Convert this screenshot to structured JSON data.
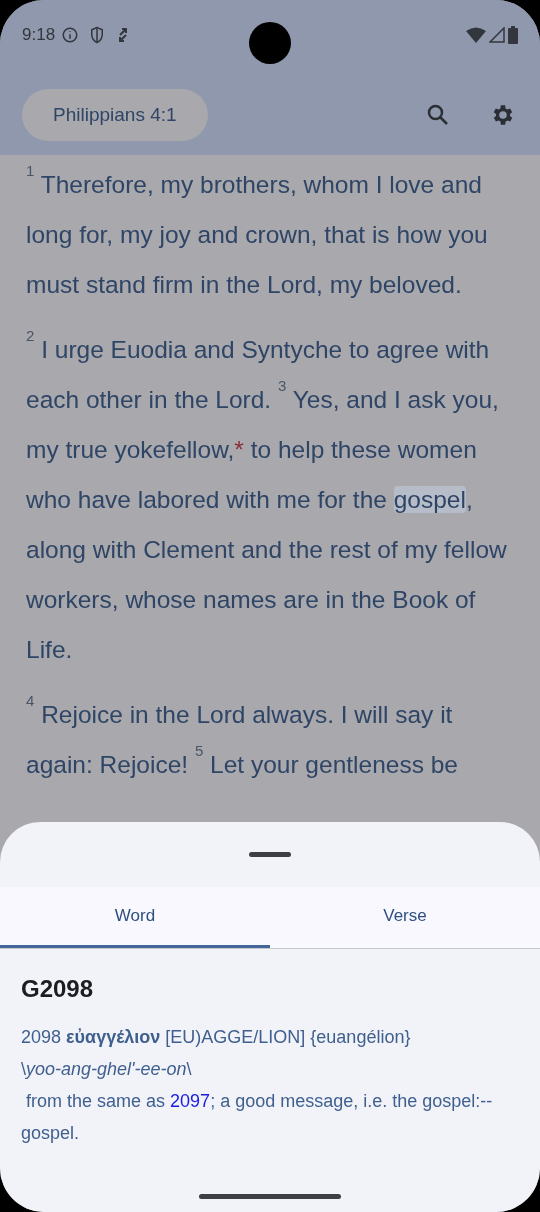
{
  "status_bar": {
    "time": "9:18"
  },
  "app_bar": {
    "reference": "Philippians 4:1"
  },
  "passage": [
    {
      "segments": [
        {
          "kind": "verse_number",
          "text": "1"
        },
        {
          "kind": "text",
          "text": " Therefore, my brothers, whom I love and long for, my joy and crown, that is how you must stand firm in the Lord, my beloved."
        }
      ]
    },
    {
      "segments": [
        {
          "kind": "verse_number",
          "text": "2"
        },
        {
          "kind": "text",
          "text": " I urge Euodia and Syntyche to agree with each other in the Lord. "
        },
        {
          "kind": "verse_number",
          "text": "3"
        },
        {
          "kind": "text",
          "text": " Yes, and I ask you, my true yokefellow,"
        },
        {
          "kind": "footnote_mark",
          "text": "*"
        },
        {
          "kind": "text",
          "text": " to help these women who have labored with me for the "
        },
        {
          "kind": "highlight",
          "text": "gospel"
        },
        {
          "kind": "text",
          "text": ", along with Clement and the rest of my fellow workers, whose names are in the Book of Life."
        }
      ]
    },
    {
      "segments": [
        {
          "kind": "verse_number",
          "text": "4"
        },
        {
          "kind": "text",
          "text": " Rejoice in the Lord always. I will say it again: Rejoice! "
        },
        {
          "kind": "verse_number",
          "text": "5"
        },
        {
          "kind": "text",
          "text": " Let your gentleness be"
        }
      ]
    }
  ],
  "sheet": {
    "tabs": [
      {
        "label": "Word",
        "selected": true
      },
      {
        "label": "Verse",
        "selected": false
      }
    ],
    "entry": {
      "title": "G2098",
      "head": "2098 **εὐαγγέλιον** [EU)AGGE/LION] {euangélion}",
      "pronunciation": "\\*yoo-ang-ghel'-ee-on*\\",
      "text_before": " from the same as ",
      "link": "2097",
      "text_after": "; a good message, i.e. the gospel:--gospel."
    }
  }
}
